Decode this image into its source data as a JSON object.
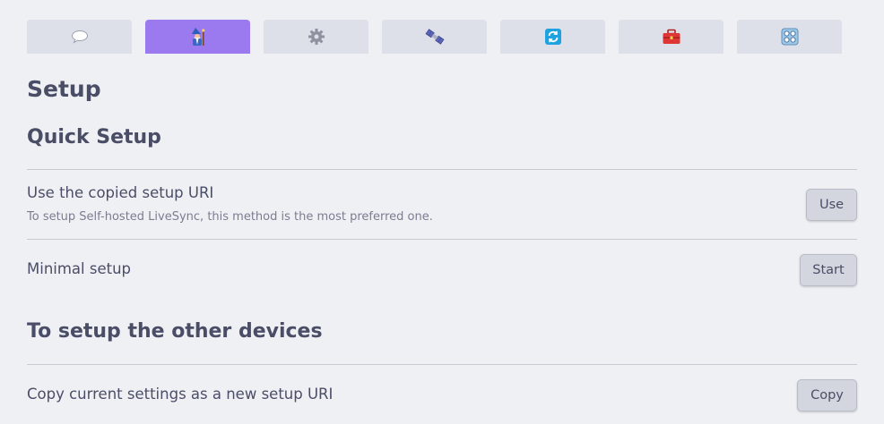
{
  "tabs": [
    {
      "icon": "speech-bubble-icon",
      "active": false
    },
    {
      "icon": "wizard-icon",
      "active": true
    },
    {
      "icon": "gear-icon",
      "active": false
    },
    {
      "icon": "satellite-icon",
      "active": false
    },
    {
      "icon": "sync-arrows-icon",
      "active": false
    },
    {
      "icon": "toolbox-icon",
      "active": false
    },
    {
      "icon": "control-knobs-icon",
      "active": false
    }
  ],
  "colors": {
    "active_tab": "#9b7af0",
    "tab": "#dde0e8",
    "background": "#eff0f4",
    "text": "#4a4d66",
    "button": "#d4d6df"
  },
  "page": {
    "title": "Setup"
  },
  "quick_setup": {
    "heading": "Quick Setup",
    "use_uri": {
      "name": "Use the copied setup URI",
      "description": "To setup Self-hosted LiveSync, this method is the most preferred one.",
      "button": "Use"
    },
    "minimal": {
      "name": "Minimal setup",
      "button": "Start"
    }
  },
  "other_devices": {
    "heading": "To setup the other devices",
    "copy_uri": {
      "name": "Copy current settings as a new setup URI",
      "button": "Copy"
    }
  }
}
